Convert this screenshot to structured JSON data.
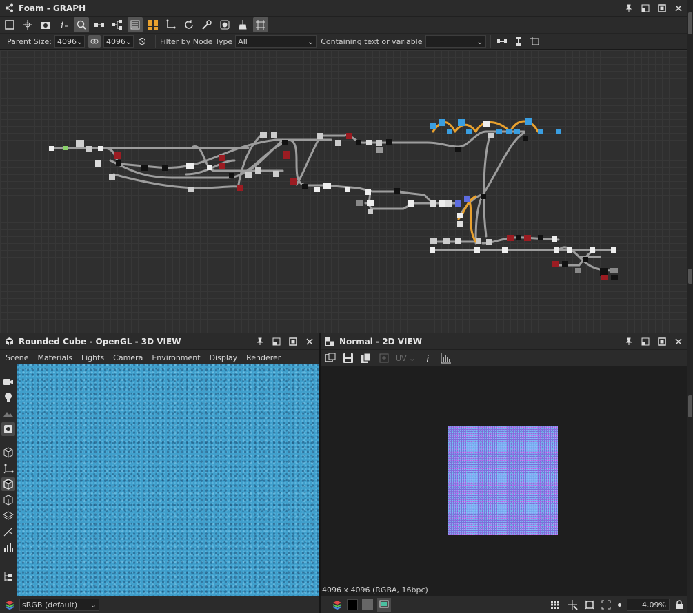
{
  "graph_panel": {
    "title": "Foam - GRAPH",
    "parent_size_label": "Parent Size:",
    "parent_size_value": "4096",
    "size_value": "4096",
    "filter_label": "Filter by Node Type",
    "filter_value": "All",
    "containing_label": "Containing text or variable",
    "containing_value": ""
  },
  "view3d_panel": {
    "title": "Rounded Cube - OpenGL - 3D VIEW",
    "menu": [
      "Scene",
      "Materials",
      "Lights",
      "Camera",
      "Environment",
      "Display",
      "Renderer"
    ],
    "colorspace": "sRGB (default)"
  },
  "view2d_panel": {
    "title": "Normal - 2D VIEW",
    "uv_label": "UV",
    "info_text": "4096 x 4096 (RGBA, 16bpc)",
    "zoom": "4.09%"
  },
  "colors": {
    "accent": "#4a4a4a",
    "link_highlight": "#e9a12e",
    "node_blue": "#3a9ee0",
    "node_red": "#9b1c22"
  }
}
